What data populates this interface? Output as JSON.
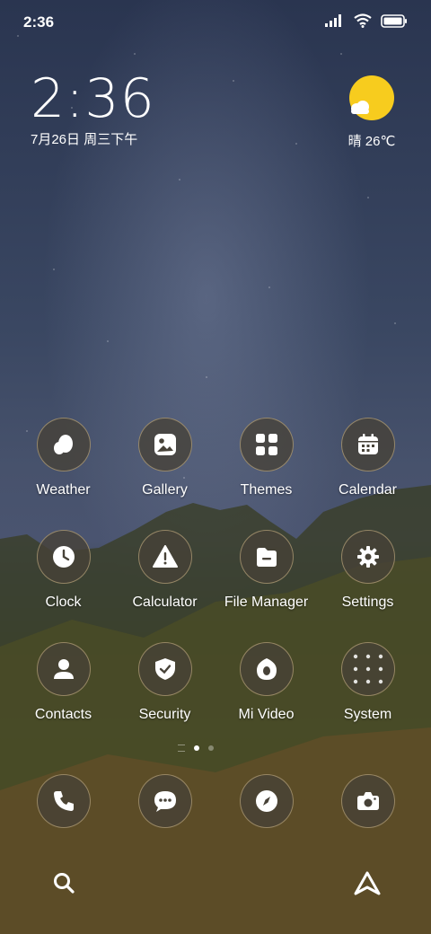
{
  "status_bar": {
    "time": "2:36"
  },
  "clock_widget": {
    "time": "2:36",
    "date": "7月26日 周三下午"
  },
  "weather_widget": {
    "text": "晴 26℃"
  },
  "apps": [
    [
      {
        "label": "Weather",
        "icon": "weather-icon"
      },
      {
        "label": "Gallery",
        "icon": "gallery-icon"
      },
      {
        "label": "Themes",
        "icon": "themes-icon"
      },
      {
        "label": "Calendar",
        "icon": "calendar-icon"
      }
    ],
    [
      {
        "label": "Clock",
        "icon": "clock-icon"
      },
      {
        "label": "Calculator",
        "icon": "calculator-icon"
      },
      {
        "label": "File Manager",
        "icon": "file-manager-icon"
      },
      {
        "label": "Settings",
        "icon": "gear-icon"
      }
    ],
    [
      {
        "label": "Contacts",
        "icon": "contacts-icon"
      },
      {
        "label": "Security",
        "icon": "shield-icon"
      },
      {
        "label": "Mi Video",
        "icon": "video-icon"
      },
      {
        "label": "System",
        "icon": "folder-icon"
      }
    ]
  ],
  "page_indicator": {
    "current": 1,
    "pages": 2
  },
  "dock": [
    {
      "icon": "phone-icon"
    },
    {
      "icon": "messages-icon"
    },
    {
      "icon": "browser-icon"
    },
    {
      "icon": "camera-icon"
    }
  ],
  "colors": {
    "sun": "#f7cc1e",
    "icon_ring": "#d7be8c"
  }
}
